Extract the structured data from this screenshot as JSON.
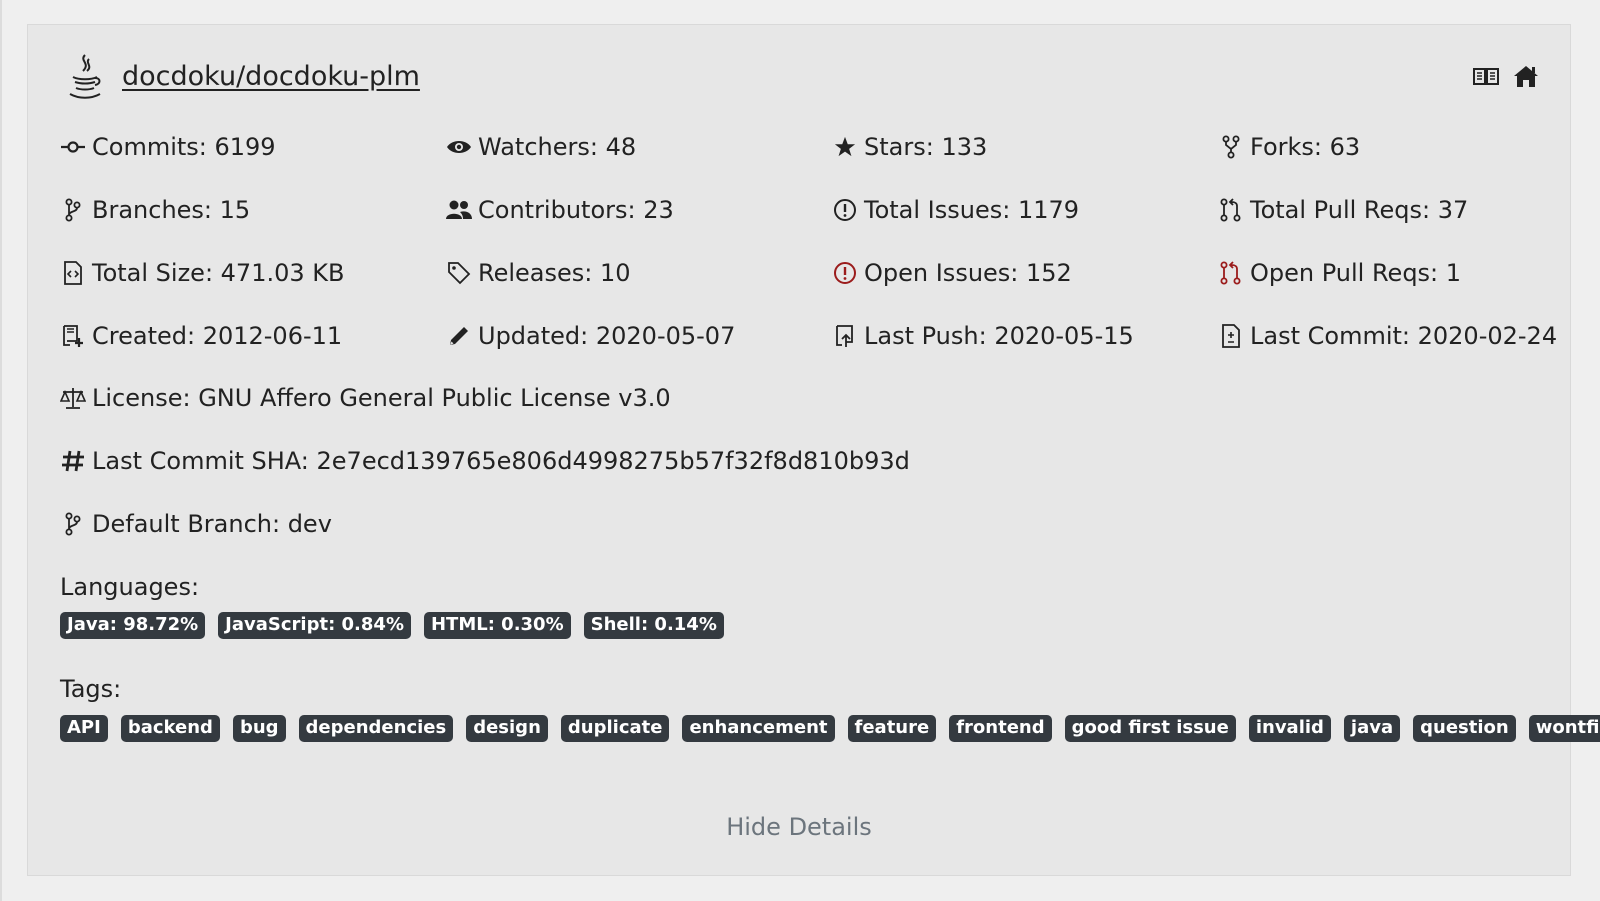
{
  "repo": {
    "name": "docdoku/docdoku-plm",
    "language_icon": "java-cup-icon"
  },
  "header_actions": [
    {
      "icon": "book-open-icon"
    },
    {
      "icon": "home-icon"
    }
  ],
  "stats": {
    "commits": "Commits: 6199",
    "watchers": "Watchers: 48",
    "stars": "Stars: 133",
    "forks": "Forks: 63",
    "branches": "Branches: 15",
    "contributors": "Contributors: 23",
    "total_issues": "Total Issues: 1179",
    "total_pull_reqs": "Total Pull Reqs: 37",
    "total_size": "Total Size: 471.03 KB",
    "releases": "Releases: 10",
    "open_issues": "Open Issues: 152",
    "open_pull_reqs": "Open Pull Reqs: 1",
    "created": "Created: 2012-06-11",
    "updated": "Updated: 2020-05-07",
    "last_push": "Last Push: 2020-05-15",
    "last_commit": "Last Commit: 2020-02-24"
  },
  "license": "License: GNU Affero General Public License v3.0",
  "last_commit_sha": "Last Commit SHA: 2e7ecd139765e806d4998275b57f32f8d810b93d",
  "default_branch": "Default Branch: dev",
  "languages_label": "Languages:",
  "languages": [
    "Java: 98.72%",
    "JavaScript: 0.84%",
    "HTML: 0.30%",
    "Shell: 0.14%"
  ],
  "tags_label": "Tags:",
  "tags": [
    "API",
    "backend",
    "bug",
    "dependencies",
    "design",
    "duplicate",
    "enhancement",
    "feature",
    "frontend",
    "good first issue",
    "invalid",
    "java",
    "question",
    "wontfix"
  ],
  "hide_details": "Hide Details",
  "colors": {
    "badge_bg": "#343a40",
    "alert_red": "#9b1c1c",
    "muted": "#6c757d"
  }
}
